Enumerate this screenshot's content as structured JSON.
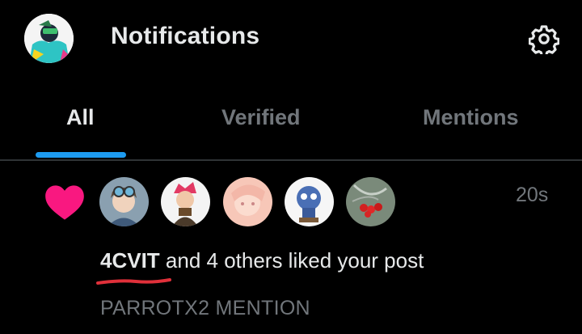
{
  "header": {
    "title": "Notifications",
    "avatar_icon": "user-avatar",
    "settings_icon": "gear-icon"
  },
  "tabs": [
    {
      "label": "All",
      "active": true
    },
    {
      "label": "Verified",
      "active": false
    },
    {
      "label": "Mentions",
      "active": false
    }
  ],
  "notification": {
    "type_icon": "heart-icon",
    "time": "20s",
    "username": "4CVIT",
    "message": " and 4 others liked your post",
    "post_preview": "PARROTX2 MENTION",
    "avatar_count": 5
  },
  "colors": {
    "background": "#000000",
    "accent": "#1d9bf0",
    "heart": "#f91880",
    "muted": "#71767b",
    "annotation": "#e0303a"
  }
}
